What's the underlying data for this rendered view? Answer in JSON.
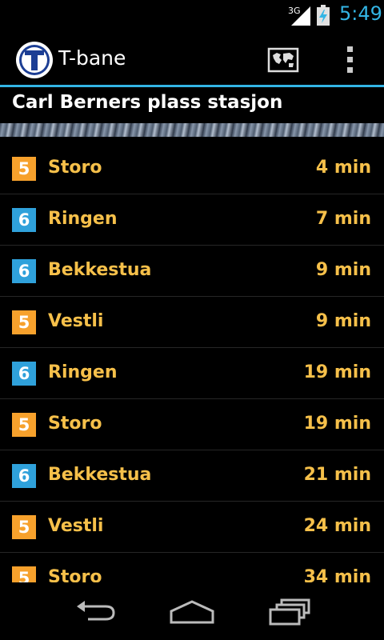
{
  "status_bar": {
    "network": "3G",
    "time": "5:49",
    "accent_color": "#33b5e5"
  },
  "action_bar": {
    "logo_letter": "T",
    "title": "T-bane",
    "map_icon": "map-icon",
    "menu_icon": "overflow-menu-icon"
  },
  "station": {
    "name": "Carl Berners plass stasjon"
  },
  "departures": [
    {
      "line": "5",
      "destination": "Storo",
      "eta": "4 min"
    },
    {
      "line": "6",
      "destination": "Ringen",
      "eta": "7 min"
    },
    {
      "line": "6",
      "destination": "Bekkestua",
      "eta": "9 min"
    },
    {
      "line": "5",
      "destination": "Vestli",
      "eta": "9 min"
    },
    {
      "line": "6",
      "destination": "Ringen",
      "eta": "19 min"
    },
    {
      "line": "5",
      "destination": "Storo",
      "eta": "19 min"
    },
    {
      "line": "6",
      "destination": "Bekkestua",
      "eta": "21 min"
    },
    {
      "line": "5",
      "destination": "Vestli",
      "eta": "24 min"
    },
    {
      "line": "5",
      "destination": "Storo",
      "eta": "34 min"
    }
  ],
  "line_colors": {
    "5": "#f7a12c",
    "6": "#2fa1db"
  },
  "nav_bar": {
    "back_icon": "back-icon",
    "home_icon": "home-icon",
    "recent_icon": "recent-apps-icon"
  }
}
